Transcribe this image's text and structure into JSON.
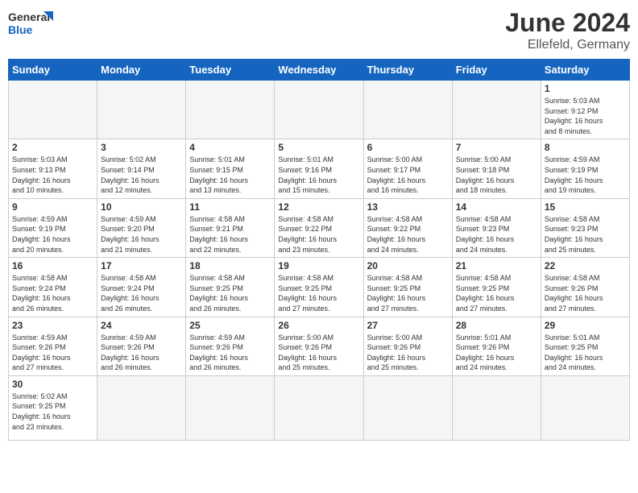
{
  "header": {
    "logo_general": "General",
    "logo_blue": "Blue",
    "month": "June 2024",
    "location": "Ellefeld, Germany"
  },
  "days_of_week": [
    "Sunday",
    "Monday",
    "Tuesday",
    "Wednesday",
    "Thursday",
    "Friday",
    "Saturday"
  ],
  "weeks": [
    [
      {
        "day": "",
        "info": "",
        "empty": true
      },
      {
        "day": "",
        "info": "",
        "empty": true
      },
      {
        "day": "",
        "info": "",
        "empty": true
      },
      {
        "day": "",
        "info": "",
        "empty": true
      },
      {
        "day": "",
        "info": "",
        "empty": true
      },
      {
        "day": "",
        "info": "",
        "empty": true
      },
      {
        "day": "1",
        "info": "Sunrise: 5:03 AM\nSunset: 9:12 PM\nDaylight: 16 hours\nand 8 minutes.",
        "empty": false
      }
    ],
    [
      {
        "day": "2",
        "info": "Sunrise: 5:03 AM\nSunset: 9:13 PM\nDaylight: 16 hours\nand 10 minutes.",
        "empty": false
      },
      {
        "day": "3",
        "info": "Sunrise: 5:02 AM\nSunset: 9:14 PM\nDaylight: 16 hours\nand 12 minutes.",
        "empty": false
      },
      {
        "day": "4",
        "info": "Sunrise: 5:01 AM\nSunset: 9:15 PM\nDaylight: 16 hours\nand 13 minutes.",
        "empty": false
      },
      {
        "day": "5",
        "info": "Sunrise: 5:01 AM\nSunset: 9:16 PM\nDaylight: 16 hours\nand 15 minutes.",
        "empty": false
      },
      {
        "day": "6",
        "info": "Sunrise: 5:00 AM\nSunset: 9:17 PM\nDaylight: 16 hours\nand 16 minutes.",
        "empty": false
      },
      {
        "day": "7",
        "info": "Sunrise: 5:00 AM\nSunset: 9:18 PM\nDaylight: 16 hours\nand 18 minutes.",
        "empty": false
      },
      {
        "day": "8",
        "info": "Sunrise: 4:59 AM\nSunset: 9:19 PM\nDaylight: 16 hours\nand 19 minutes.",
        "empty": false
      }
    ],
    [
      {
        "day": "9",
        "info": "Sunrise: 4:59 AM\nSunset: 9:19 PM\nDaylight: 16 hours\nand 20 minutes.",
        "empty": false
      },
      {
        "day": "10",
        "info": "Sunrise: 4:59 AM\nSunset: 9:20 PM\nDaylight: 16 hours\nand 21 minutes.",
        "empty": false
      },
      {
        "day": "11",
        "info": "Sunrise: 4:58 AM\nSunset: 9:21 PM\nDaylight: 16 hours\nand 22 minutes.",
        "empty": false
      },
      {
        "day": "12",
        "info": "Sunrise: 4:58 AM\nSunset: 9:22 PM\nDaylight: 16 hours\nand 23 minutes.",
        "empty": false
      },
      {
        "day": "13",
        "info": "Sunrise: 4:58 AM\nSunset: 9:22 PM\nDaylight: 16 hours\nand 24 minutes.",
        "empty": false
      },
      {
        "day": "14",
        "info": "Sunrise: 4:58 AM\nSunset: 9:23 PM\nDaylight: 16 hours\nand 24 minutes.",
        "empty": false
      },
      {
        "day": "15",
        "info": "Sunrise: 4:58 AM\nSunset: 9:23 PM\nDaylight: 16 hours\nand 25 minutes.",
        "empty": false
      }
    ],
    [
      {
        "day": "16",
        "info": "Sunrise: 4:58 AM\nSunset: 9:24 PM\nDaylight: 16 hours\nand 26 minutes.",
        "empty": false
      },
      {
        "day": "17",
        "info": "Sunrise: 4:58 AM\nSunset: 9:24 PM\nDaylight: 16 hours\nand 26 minutes.",
        "empty": false
      },
      {
        "day": "18",
        "info": "Sunrise: 4:58 AM\nSunset: 9:25 PM\nDaylight: 16 hours\nand 26 minutes.",
        "empty": false
      },
      {
        "day": "19",
        "info": "Sunrise: 4:58 AM\nSunset: 9:25 PM\nDaylight: 16 hours\nand 27 minutes.",
        "empty": false
      },
      {
        "day": "20",
        "info": "Sunrise: 4:58 AM\nSunset: 9:25 PM\nDaylight: 16 hours\nand 27 minutes.",
        "empty": false
      },
      {
        "day": "21",
        "info": "Sunrise: 4:58 AM\nSunset: 9:25 PM\nDaylight: 16 hours\nand 27 minutes.",
        "empty": false
      },
      {
        "day": "22",
        "info": "Sunrise: 4:58 AM\nSunset: 9:26 PM\nDaylight: 16 hours\nand 27 minutes.",
        "empty": false
      }
    ],
    [
      {
        "day": "23",
        "info": "Sunrise: 4:59 AM\nSunset: 9:26 PM\nDaylight: 16 hours\nand 27 minutes.",
        "empty": false
      },
      {
        "day": "24",
        "info": "Sunrise: 4:59 AM\nSunset: 9:26 PM\nDaylight: 16 hours\nand 26 minutes.",
        "empty": false
      },
      {
        "day": "25",
        "info": "Sunrise: 4:59 AM\nSunset: 9:26 PM\nDaylight: 16 hours\nand 26 minutes.",
        "empty": false
      },
      {
        "day": "26",
        "info": "Sunrise: 5:00 AM\nSunset: 9:26 PM\nDaylight: 16 hours\nand 25 minutes.",
        "empty": false
      },
      {
        "day": "27",
        "info": "Sunrise: 5:00 AM\nSunset: 9:26 PM\nDaylight: 16 hours\nand 25 minutes.",
        "empty": false
      },
      {
        "day": "28",
        "info": "Sunrise: 5:01 AM\nSunset: 9:26 PM\nDaylight: 16 hours\nand 24 minutes.",
        "empty": false
      },
      {
        "day": "29",
        "info": "Sunrise: 5:01 AM\nSunset: 9:25 PM\nDaylight: 16 hours\nand 24 minutes.",
        "empty": false
      }
    ],
    [
      {
        "day": "30",
        "info": "Sunrise: 5:02 AM\nSunset: 9:25 PM\nDaylight: 16 hours\nand 23 minutes.",
        "empty": false
      },
      {
        "day": "",
        "info": "",
        "empty": true
      },
      {
        "day": "",
        "info": "",
        "empty": true
      },
      {
        "day": "",
        "info": "",
        "empty": true
      },
      {
        "day": "",
        "info": "",
        "empty": true
      },
      {
        "day": "",
        "info": "",
        "empty": true
      },
      {
        "day": "",
        "info": "",
        "empty": true
      }
    ]
  ]
}
